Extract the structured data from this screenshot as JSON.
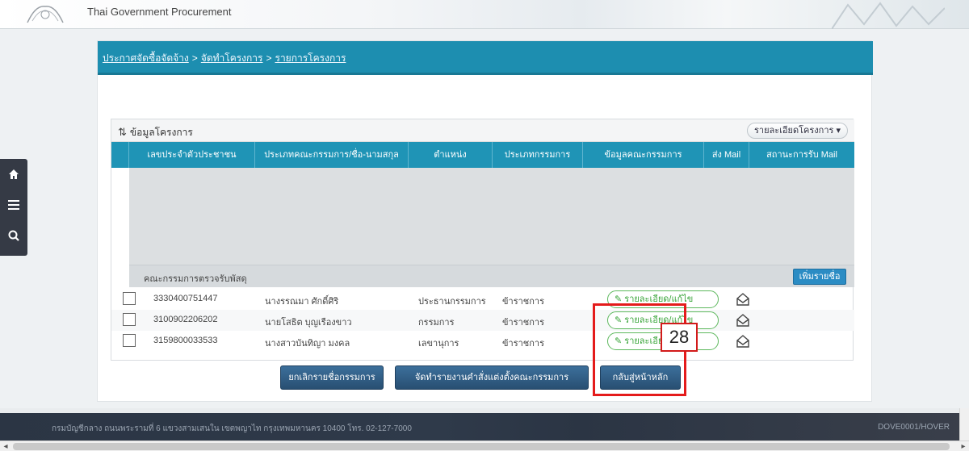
{
  "header": {
    "site_title": "Thai Government Procurement"
  },
  "breadcrumb": {
    "items": [
      "ประกาศจัดซื้อจัดจ้าง",
      "จัดทำโครงการ",
      "รายการโครงการ"
    ],
    "separator": ">"
  },
  "panel": {
    "title": "ข้อมูลโครงการ",
    "detail_dropdown": "รายละเอียดโครงการ ▾"
  },
  "table": {
    "columns": [
      "เลขประจำตัวประชาชน",
      "ประเภทคณะกรรมการ/ชื่อ-นามสกุล",
      "ตำแหน่ง",
      "ประเภทกรรมการ",
      "ข้อมูลคณะกรรมการ",
      "ส่ง Mail",
      "สถานะการรับ Mail"
    ]
  },
  "committee_section": {
    "title": "คณะกรรมการตรวจรับพัสดุ",
    "add_button": "เพิ่มรายชื่อ",
    "rows": [
      {
        "id": "3330400751447",
        "name": "นางรรณมา ศักดิ์ศิริ",
        "position": "ประธานกรรมการ",
        "type": "ข้าราชการ",
        "action": "รายละเอียด/แก้ไข"
      },
      {
        "id": "3100902206202",
        "name": "นายโสธิต บุญเรืองขาว",
        "position": "กรรมการ",
        "type": "ข้าราชการ",
        "action": "รายละเอียด/แก้ไข"
      },
      {
        "id": "3159800033533",
        "name": "นางสาวบันทิญา มงคล",
        "position": "เลขานุการ",
        "type": "ข้าราชการ",
        "action": "รายละเอียด/แก้ไข"
      }
    ]
  },
  "buttons": {
    "cancel_committee": "ยกเลิกรายชื่อกรรมการ",
    "print_order": "จัดทำรายงานคำสั่งแต่งตั้งคณะกรรมการ",
    "back_home": "กลับสู่หน้าหลัก"
  },
  "annotation": {
    "number": "28"
  },
  "footer": {
    "text": "กรมบัญชีกลาง ถนนพระรามที่ 6 แขวงสามเสนใน เขตพญาไท กรุงเทพมหานคร 10400 โทร. 02-127-7000",
    "code": "DOVE0001/HOVER"
  },
  "colors": {
    "accent": "#1d8eb0",
    "header_row": "#1f94b6",
    "callout": "#e41b1b",
    "action_button": "#2f5e86"
  }
}
